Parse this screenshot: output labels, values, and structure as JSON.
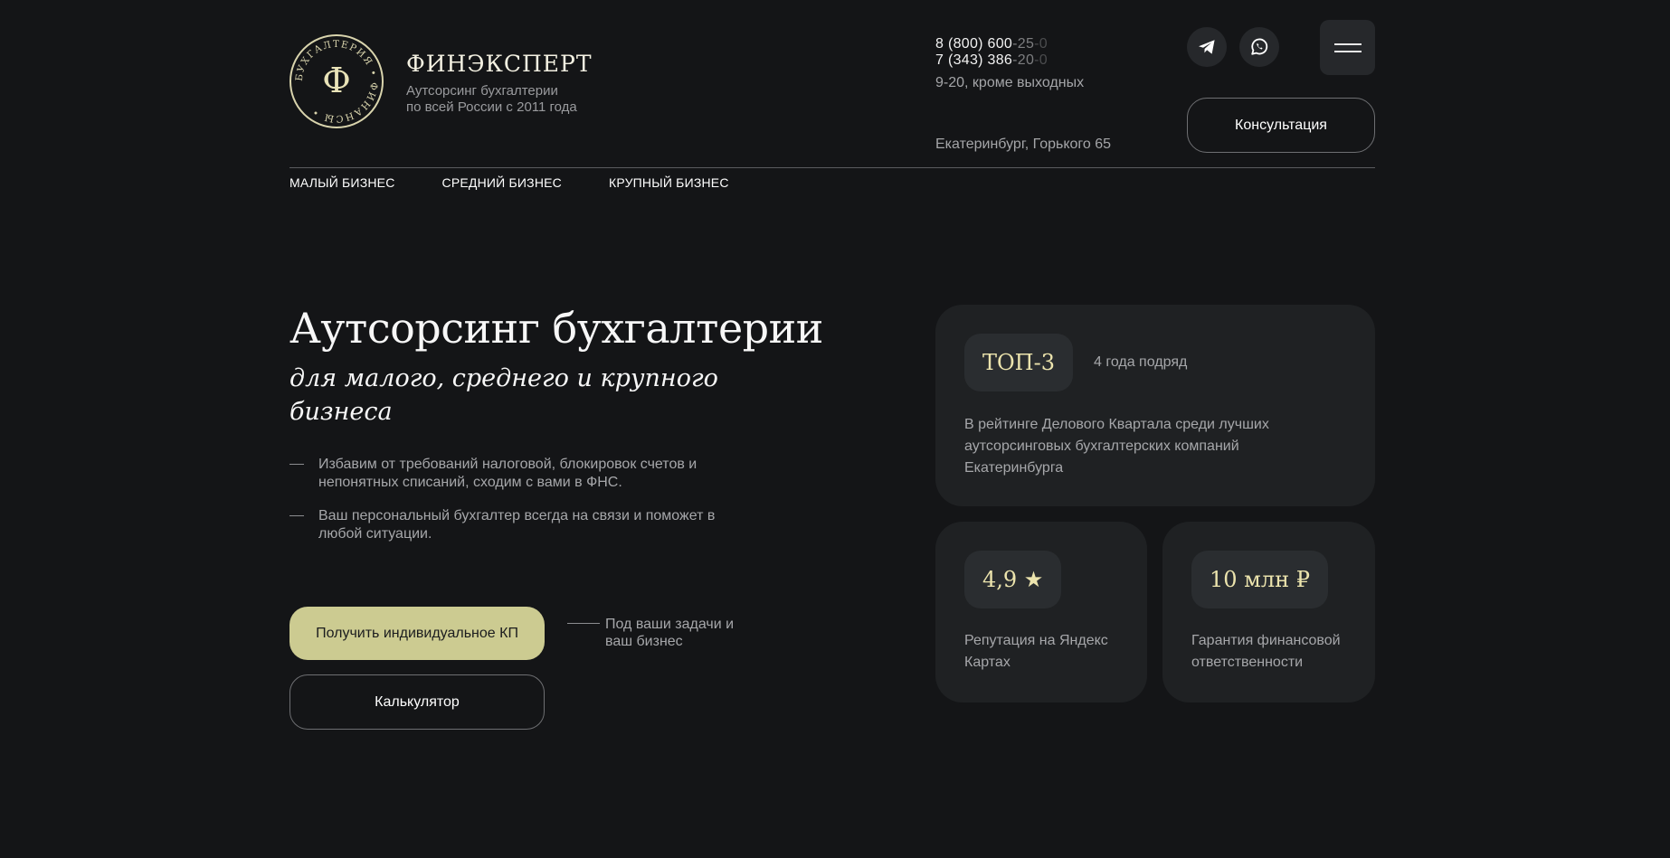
{
  "brand": {
    "seal_letter": "Ф",
    "seal_ring_text": "БУХГАЛТЕРИЯ • ФИНАНСЫ •",
    "name": "ФИНЭКСПЕРТ",
    "tagline_line1": "Аутсорсинг бухгалтерии",
    "tagline_line2": "по всей России с 2011 года"
  },
  "contacts": {
    "phone1_main": "8 (800) 600",
    "phone1_tail1": "-25",
    "phone1_tail2": "-0",
    "phone2_main": "7 (343) 386",
    "phone2_tail1": "-20",
    "phone2_tail2": "-0",
    "hours": "9-20, кроме выходных",
    "address": "Екатеринбург, Горького 65"
  },
  "header": {
    "consult_label": "Консультация"
  },
  "nav": {
    "small": "МАЛЫЙ БИЗНЕС",
    "medium": "СРЕДНИЙ БИЗНЕС",
    "large": "КРУПНЫЙ БИЗНЕС"
  },
  "hero": {
    "title": "Аутсорсинг бухгалтерии",
    "subtitle": "для малого, среднего и крупного бизнеса",
    "bullet1": "Избавим от требований налоговой, блокировок счетов и непонятных списаний, сходим с вами в ФНС.",
    "bullet2": "Ваш персональный бухгалтер всегда на связи и поможет в любой ситуации.",
    "cta_primary": "Получить индивидуальное КП",
    "cta_note": "Под ваши задачи и ваш бизнес",
    "cta_secondary": "Калькулятор"
  },
  "cards": {
    "top_badge": "ТОП-3",
    "top_note": "4 года подряд",
    "top_text": "В рейтинге Делового Квартала среди лучших аутсорсинговых бухгалтерских компаний Екатеринбурга",
    "rating_badge": "4,9 ★",
    "rating_text": "Репутация на Яндекс Картах",
    "guarantee_badge": "10 млн ₽",
    "guarantee_text": "Гарантия финансовой ответственности"
  },
  "colors": {
    "background": "#141517",
    "card": "#1f2123",
    "accent": "#cccb91",
    "gold_text": "#ece4ad"
  },
  "icons": [
    "telegram-icon",
    "whatsapp-icon",
    "menu-icon"
  ]
}
